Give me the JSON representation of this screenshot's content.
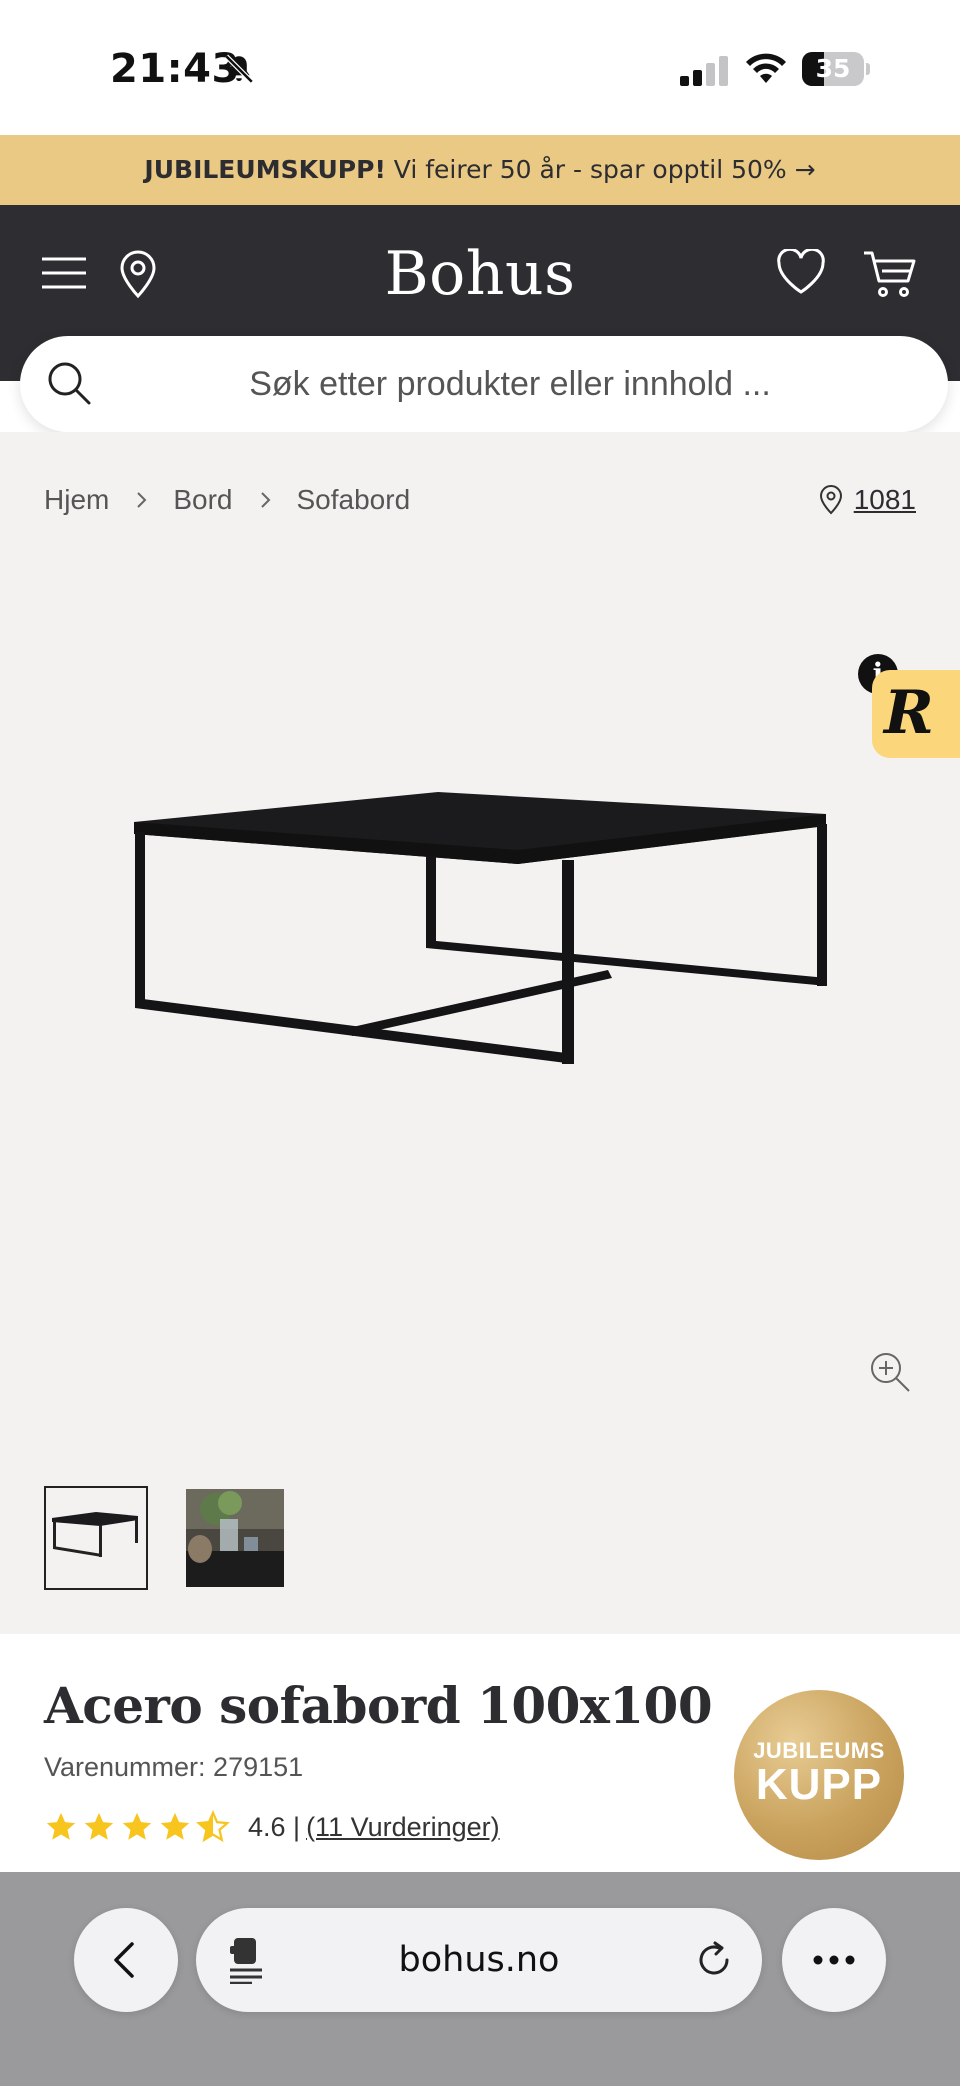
{
  "status_bar": {
    "time": "21:43",
    "battery": "35",
    "battery_level": 0.35,
    "icons": [
      "bell-slash-icon",
      "cellular-signal-icon",
      "wifi-icon",
      "battery-icon"
    ]
  },
  "promo": {
    "bold": "JUBILEUMSKUPP!",
    "text": " Vi feirer 50 år - spar opptil 50% →",
    "color": "#e9c984"
  },
  "header": {
    "logo": "Bohus",
    "background": "#2e2e32",
    "icons": [
      "menu-icon",
      "location-pin-icon",
      "heart-icon",
      "cart-icon"
    ]
  },
  "search": {
    "placeholder": "Søk etter produkter eller innhold ..."
  },
  "breadcrumb": {
    "items": [
      "Hjem",
      "Bord",
      "Sofabord"
    ]
  },
  "store": {
    "label": "1081"
  },
  "gallery": {
    "background": "#f4f2f0",
    "thumbnails": [
      "Acero sofabord front view",
      "Acero sofabord room view"
    ]
  },
  "product": {
    "title": "Acero sofabord 100x100",
    "sku": "Varenummer: 279151",
    "rating": 4.6,
    "rating_text": "4.6 |",
    "reviews_link": "(11 Vurderinger)",
    "star_color": "#f7c51e"
  },
  "jubileum_badge": {
    "line1": "JUBILEUMS",
    "line2": "KUPP",
    "color": "#c9a25d"
  },
  "browser": {
    "url": "bohus.no"
  }
}
